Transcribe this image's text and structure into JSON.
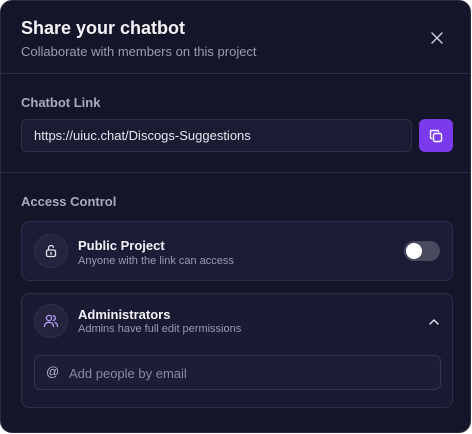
{
  "header": {
    "title": "Share your chatbot",
    "subtitle": "Collaborate with members on this project"
  },
  "link_section": {
    "label": "Chatbot Link",
    "url": "https://uiuc.chat/Discogs-Suggestions"
  },
  "access_section": {
    "label": "Access Control",
    "public_project": {
      "title": "Public Project",
      "description": "Anyone with the link can access",
      "enabled": false
    },
    "administrators": {
      "title": "Administrators",
      "description": "Admins have full edit permissions",
      "expanded": true,
      "email_placeholder": "Add people by email",
      "at_symbol": "@"
    }
  },
  "colors": {
    "modal_bg": "#15152a",
    "accent": "#7c3aed",
    "text_primary": "#f2f2f7",
    "text_secondary": "#9a9ab3"
  }
}
